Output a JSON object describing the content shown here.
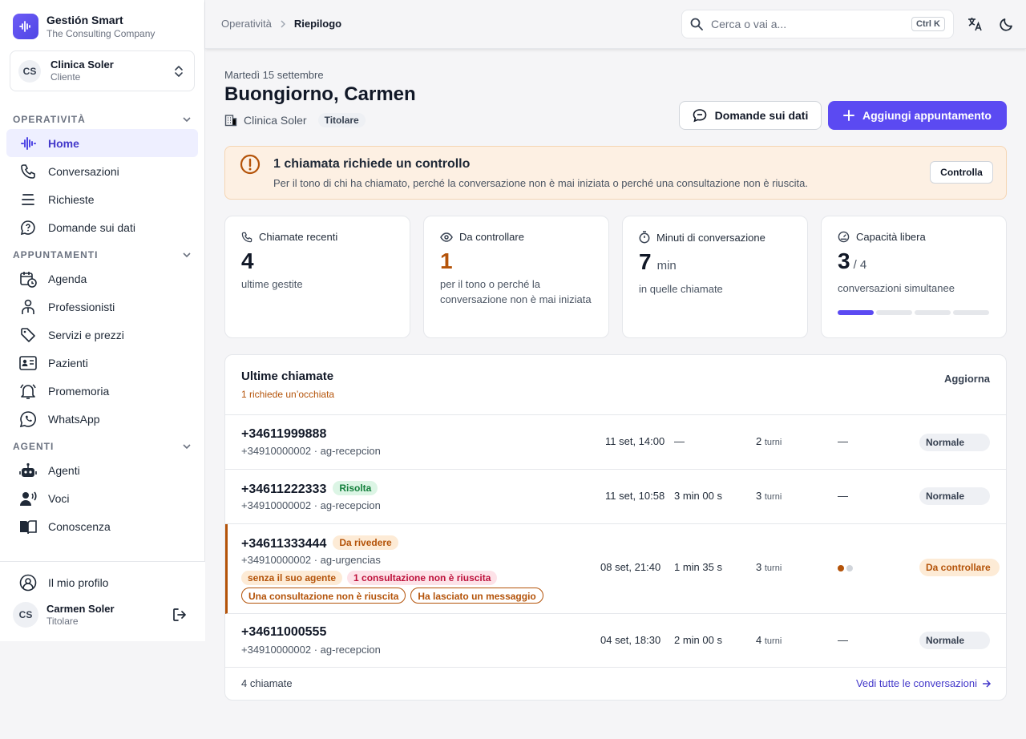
{
  "brand": {
    "title": "Gestión Smart",
    "subtitle": "The Consulting Company"
  },
  "client": {
    "initials": "CS",
    "name": "Clinica Soler",
    "role": "Cliente"
  },
  "sidebar": {
    "sections": [
      {
        "title": "OPERATIVITÀ",
        "items": [
          {
            "label": "Home",
            "icon": "waveform-icon",
            "active": true
          },
          {
            "label": "Conversazioni",
            "icon": "phone-icon"
          },
          {
            "label": "Richieste",
            "icon": "list-icon"
          },
          {
            "label": "Domande sui dati",
            "icon": "chat-help-icon"
          }
        ]
      },
      {
        "title": "APPUNTAMENTI",
        "items": [
          {
            "label": "Agenda",
            "icon": "calendar-clock-icon"
          },
          {
            "label": "Professionisti",
            "icon": "user-tie-icon"
          },
          {
            "label": "Servizi e prezzi",
            "icon": "tags-icon"
          },
          {
            "label": "Pazienti",
            "icon": "id-card-icon"
          },
          {
            "label": "Promemoria",
            "icon": "bell-ring-icon"
          },
          {
            "label": "WhatsApp",
            "icon": "whatsapp-icon"
          }
        ]
      },
      {
        "title": "AGENTI",
        "items": [
          {
            "label": "Agenti",
            "icon": "robot-icon"
          },
          {
            "label": "Voci",
            "icon": "voice-icon"
          },
          {
            "label": "Conoscenza",
            "icon": "book-icon"
          }
        ]
      }
    ],
    "profile_link": "Il mio profilo",
    "user": {
      "initials": "CS",
      "name": "Carmen Soler",
      "role": "Titolare"
    }
  },
  "topbar": {
    "crumbs": [
      "Operatività",
      "Riepilogo"
    ],
    "search_placeholder": "Cerca o vai a...",
    "search_shortcut": "Ctrl K"
  },
  "header": {
    "date": "Martedì 15 settembre",
    "greeting": "Buongiorno, Carmen",
    "org": "Clinica Soler",
    "role_tag": "Titolare",
    "btn_questions": "Domande sui dati",
    "btn_add": "Aggiungi appuntamento"
  },
  "alert": {
    "title": "1 chiamata richiede un controllo",
    "text": "Per il tono di chi ha chiamato, perché la conversazione non è mai iniziata o perché una consultazione non è riuscita.",
    "button": "Controlla"
  },
  "stats": [
    {
      "label": "Chiamate recenti",
      "icon": "phone-icon",
      "value": "4",
      "unit": "",
      "sub": "ultime gestite"
    },
    {
      "label": "Da controllare",
      "icon": "eye-icon",
      "value": "1",
      "unit": "",
      "sub": "per il tono o perché la conversazione non è mai iniziata"
    },
    {
      "label": "Minuti di conversazione",
      "icon": "timer-icon",
      "value": "7",
      "unit": "min",
      "sub": "in quelle chiamate"
    },
    {
      "label": "Capacità libera",
      "icon": "gauge-icon",
      "value": "3",
      "unit": "/ 4",
      "sub": "conversazioni simultanee",
      "used": 1,
      "total": 4
    }
  ],
  "calls": {
    "title": "Ultime chiamate",
    "subtitle": "1 richiede un’occhiata",
    "refresh": "Aggiorna",
    "turns_label": "turni",
    "rows": [
      {
        "phone": "+34611999888",
        "meta": "+34910000002 · ag-recepcion",
        "date": "11 set, 14:00",
        "duration": "—",
        "turns": "2",
        "sentiment": "—",
        "status": "Normale"
      },
      {
        "phone": "+34611222333",
        "badge": "Risolta",
        "meta": "+34910000002 · ag-recepcion",
        "date": "11 set, 10:58",
        "duration": "3 min 00 s",
        "turns": "3",
        "sentiment": "—",
        "status": "Normale"
      },
      {
        "phone": "+34611333444",
        "badge": "Da rivedere",
        "meta": "+34910000002 · ag-urgencias",
        "chips1": [
          "senza il suo agente",
          "1 consultazione non è riuscita"
        ],
        "chips2": [
          "Una consultazione non è riuscita",
          "Ha lasciato un messaggio"
        ],
        "date": "08 set, 21:40",
        "duration": "1 min 35 s",
        "turns": "3",
        "status": "Da controllare"
      },
      {
        "phone": "+34611000555",
        "meta": "+34910000002 · ag-recepcion",
        "date": "04 set, 18:30",
        "duration": "2 min 00 s",
        "turns": "4",
        "sentiment": "—",
        "status": "Normale"
      }
    ],
    "count": "4 chiamate",
    "see_all": "Vedi tutte le conversazioni"
  }
}
